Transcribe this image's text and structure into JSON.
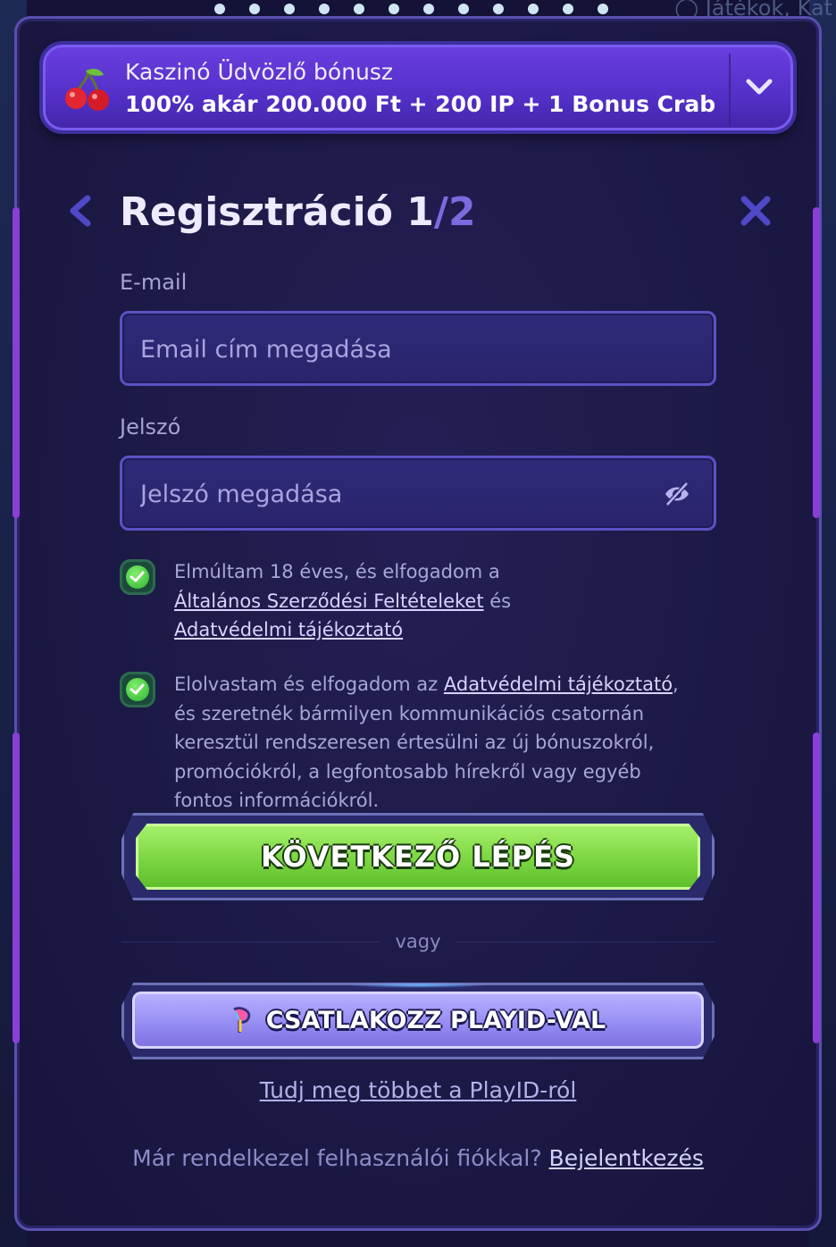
{
  "background": {
    "search_placeholder": "Játékok, Kat"
  },
  "bonus": {
    "title": "Kaszinó Üdvözlő bónusz",
    "text": "100% akár 200.000 Ft + 200 IP + 1 Bonus Crab",
    "icon": "cherry-icon"
  },
  "header": {
    "title": "Regisztráció",
    "step_current": "1",
    "step_total": "/2"
  },
  "form": {
    "email_label": "E-mail",
    "email_placeholder": "Email cím megadása",
    "password_label": "Jelszó",
    "password_placeholder": "Jelszó megadása"
  },
  "consents": {
    "age": {
      "checked": true,
      "text_before": "Elmúltam 18 éves, és elfogadom a",
      "terms_link": "Általános Szerződési Feltételeket",
      "connector": "és",
      "privacy_link": "Adatvédelmi tájékoztató"
    },
    "marketing": {
      "checked": true,
      "text_before": "Elolvastam és elfogadom az",
      "privacy_link": "Adatvédelmi tájékoztató",
      "text_after": ", és szeretnék bármilyen kommunikációs csatornán keresztül rendszeresen értesülni az új bónuszokról, promóciókról, a legfontosabb hírekről vagy egyéb fontos információkról."
    }
  },
  "actions": {
    "next_label": "KÖVETKEZŐ LÉPÉS",
    "or_label": "vagy",
    "playid_label": "CSATLAKOZZ PLAYID-VAL",
    "learn_more_label": "Tudj meg többet a PlayID-ról",
    "login_prompt": "Már rendelkezel felhasználói fiókkal?",
    "login_link": "Bejelentkezés"
  },
  "colors": {
    "accent_green": "#7fd845",
    "accent_purple": "#5330c8",
    "playid_purple": "#948af2"
  }
}
